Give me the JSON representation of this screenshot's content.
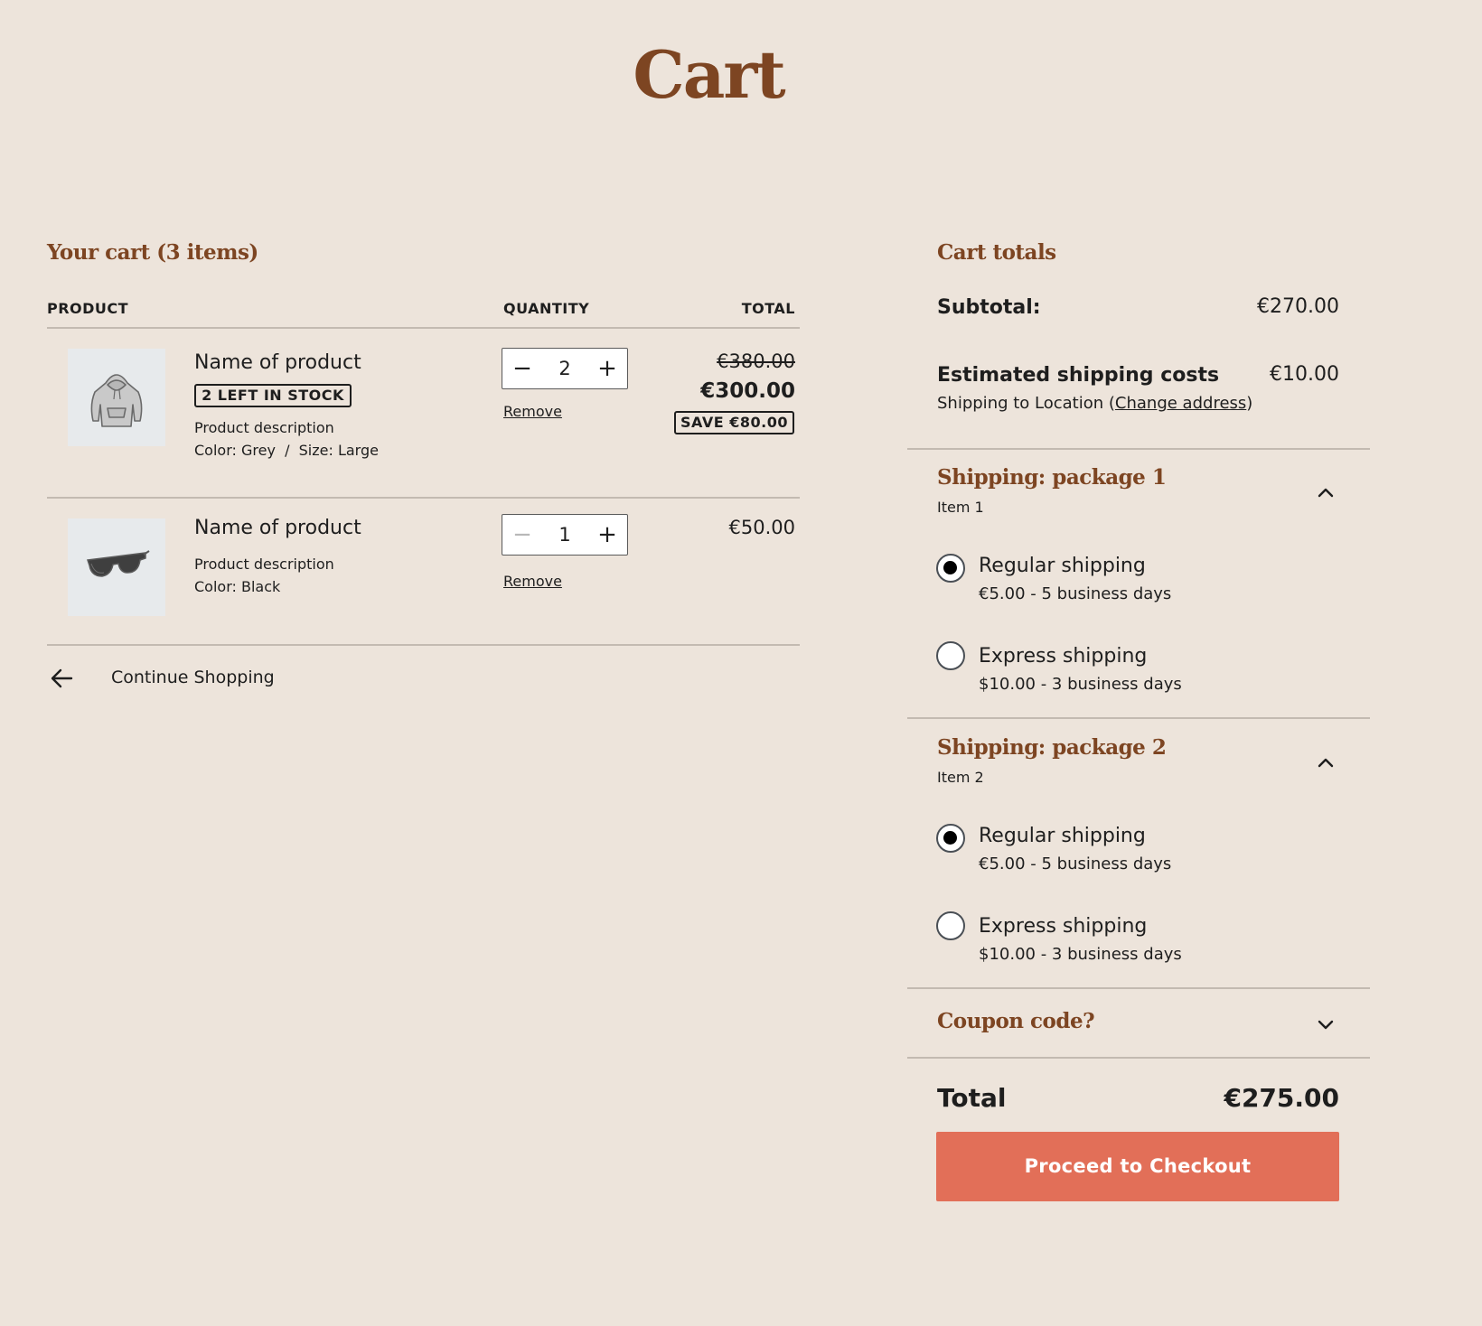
{
  "page": {
    "title": "Cart"
  },
  "cart": {
    "heading": "Your cart (3 items)",
    "columns": {
      "product": "PRODUCT",
      "quantity": "QUANTITY",
      "total": "TOTAL"
    },
    "items": [
      {
        "name": "Name of product",
        "stock_badge": "2 LEFT IN STOCK",
        "description": "Product description",
        "attributes": "Color: Grey  /  Size: Large",
        "quantity": "2",
        "original_price": "€380.00",
        "price": "€300.00",
        "save_badge": "SAVE €80.00",
        "remove_label": "Remove",
        "image_icon": "hoodie-icon"
      },
      {
        "name": "Name of product",
        "description": "Product description",
        "attributes": "Color: Black",
        "quantity": "1",
        "price": "€50.00",
        "remove_label": "Remove",
        "image_icon": "sunglasses-icon"
      }
    ],
    "continue_label": "Continue Shopping"
  },
  "totals": {
    "heading": "Cart totals",
    "subtotal_label": "Subtotal:",
    "subtotal_value": "€270.00",
    "shipping_label": "Estimated shipping costs",
    "shipping_value": "€10.00",
    "shipping_to_prefix": "Shipping to Location (",
    "change_address": "Change address",
    "shipping_to_suffix": ")",
    "packages": [
      {
        "title": "Shipping: package 1",
        "subtitle": "Item 1",
        "options": [
          {
            "title": "Regular shipping",
            "detail": "€5.00 - 5 business days",
            "selected": true
          },
          {
            "title": "Express shipping",
            "detail": "$10.00 - 3 business days",
            "selected": false
          }
        ]
      },
      {
        "title": "Shipping: package 2",
        "subtitle": "Item 2",
        "options": [
          {
            "title": "Regular shipping",
            "detail": "€5.00 - 5 business days",
            "selected": true
          },
          {
            "title": "Express shipping",
            "detail": "$10.00 - 3 business days",
            "selected": false
          }
        ]
      }
    ],
    "coupon_label": "Coupon code?",
    "total_label": "Total",
    "total_value": "€275.00",
    "checkout_label": "Proceed to Checkout"
  },
  "colors": {
    "background": "#ede4db",
    "heading_brown": "#7d4522",
    "checkout_button": "#e26f58"
  }
}
